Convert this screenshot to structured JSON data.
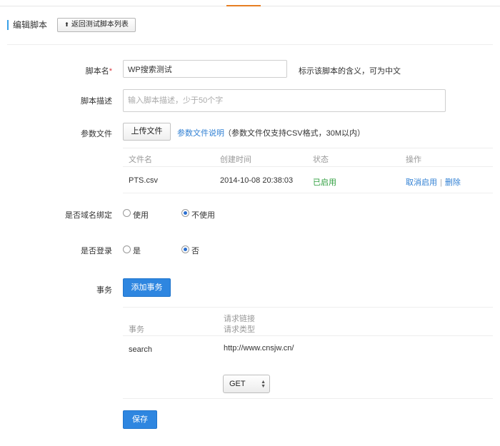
{
  "header": {
    "title": "编辑脚本",
    "back_button": "返回测试脚本列表"
  },
  "form": {
    "script_name": {
      "label": "脚本名",
      "required_mark": "*",
      "value": "WP搜索测试",
      "hint": "标示该脚本的含义，可为中文"
    },
    "script_desc": {
      "label": "脚本描述",
      "placeholder": "输入脚本描述，少于50个字"
    },
    "param_file": {
      "label": "参数文件",
      "upload_button": "上传文件",
      "help_link": "参数文件说明",
      "note": "（参数文件仅支持CSV格式，30M以内）",
      "table": {
        "headers": [
          "文件名",
          "创建时间",
          "状态",
          "操作"
        ],
        "rows": [
          {
            "filename": "PTS.csv",
            "created": "2014-10-08 20:38:03",
            "status": "已启用",
            "actions": [
              "取消启用",
              "删除"
            ],
            "action_separator": "|"
          }
        ]
      }
    },
    "domain_binding": {
      "label": "是否域名绑定",
      "options": [
        "使用",
        "不使用"
      ],
      "selected": "不使用"
    },
    "login": {
      "label": "是否登录",
      "options": [
        "是",
        "否"
      ],
      "selected": "否"
    },
    "transactions": {
      "label": "事务",
      "add_button": "添加事务",
      "table": {
        "headers": {
          "transaction": "事务",
          "request_link": "请求链接",
          "request_type": "请求类型"
        },
        "rows": [
          {
            "name": "search",
            "url": "http://www.cnsjw.cn/",
            "method": "GET"
          }
        ]
      }
    },
    "save_button": "保存"
  },
  "colors": {
    "primary_blue": "#2e86e0",
    "link_blue": "#2f7fd3",
    "status_green": "#2e9e3e",
    "required_red": "#d9363e",
    "top_accent": "#e67e22"
  },
  "icons": {
    "back": "upload-arrow-icon",
    "select": "updown-arrows-icon"
  }
}
